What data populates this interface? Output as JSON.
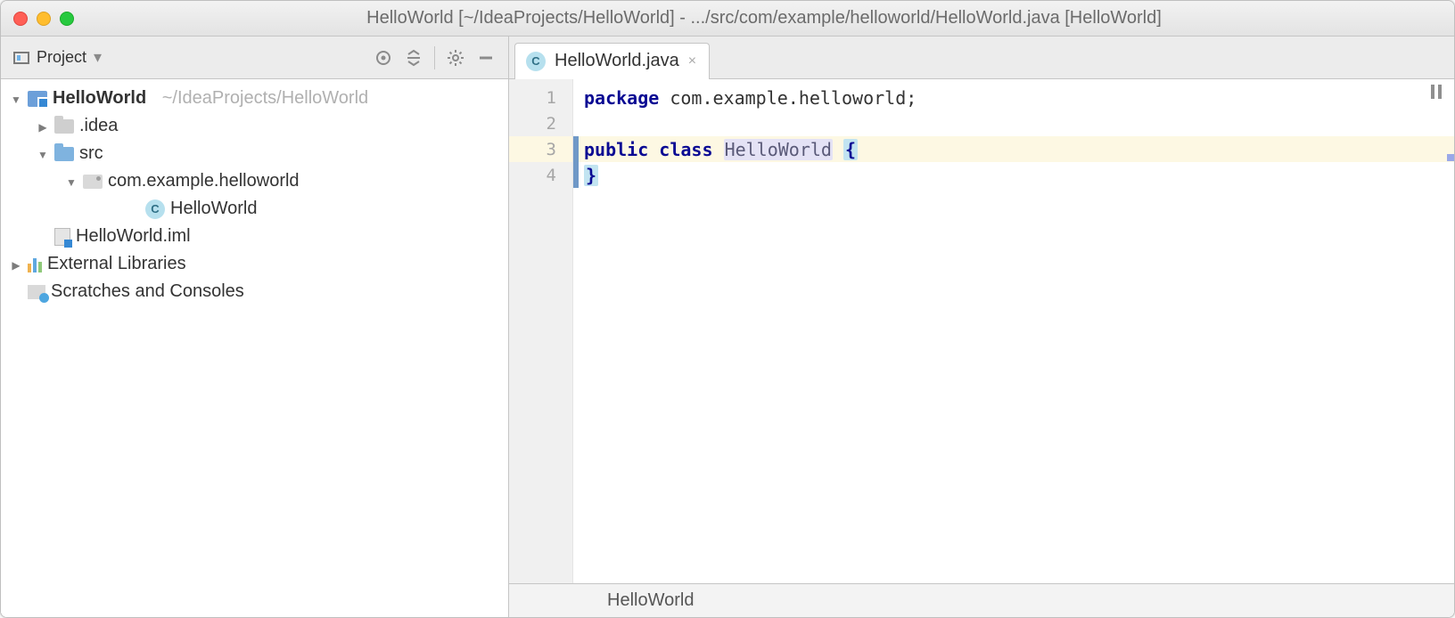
{
  "window": {
    "title": "HelloWorld [~/IdeaProjects/HelloWorld] - .../src/com/example/helloworld/HelloWorld.java [HelloWorld]"
  },
  "panel": {
    "title": "Project",
    "dropdown_glyph": "▾"
  },
  "tree": {
    "root": {
      "name": "HelloWorld",
      "path": "~/IdeaProjects/HelloWorld"
    },
    "idea": ".idea",
    "src": "src",
    "pkg": "com.example.helloworld",
    "cls": "HelloWorld",
    "iml": "HelloWorld.iml",
    "ext": "External Libraries",
    "scratch": "Scratches and Consoles",
    "c_glyph": "C"
  },
  "tab": {
    "filename": "HelloWorld.java",
    "close_glyph": "×",
    "c_glyph": "C"
  },
  "editor": {
    "lines": {
      "l1": "1",
      "l2": "2",
      "l3": "3",
      "l4": "4"
    },
    "code": {
      "kw_package": "package",
      "pkg_stmt": " com.example.helloworld;",
      "kw_public": "public",
      "kw_class": "class",
      "classname": "HelloWorld",
      "brace_open": "{",
      "brace_close": "}"
    }
  },
  "breadcrumb": {
    "text": "HelloWorld"
  }
}
